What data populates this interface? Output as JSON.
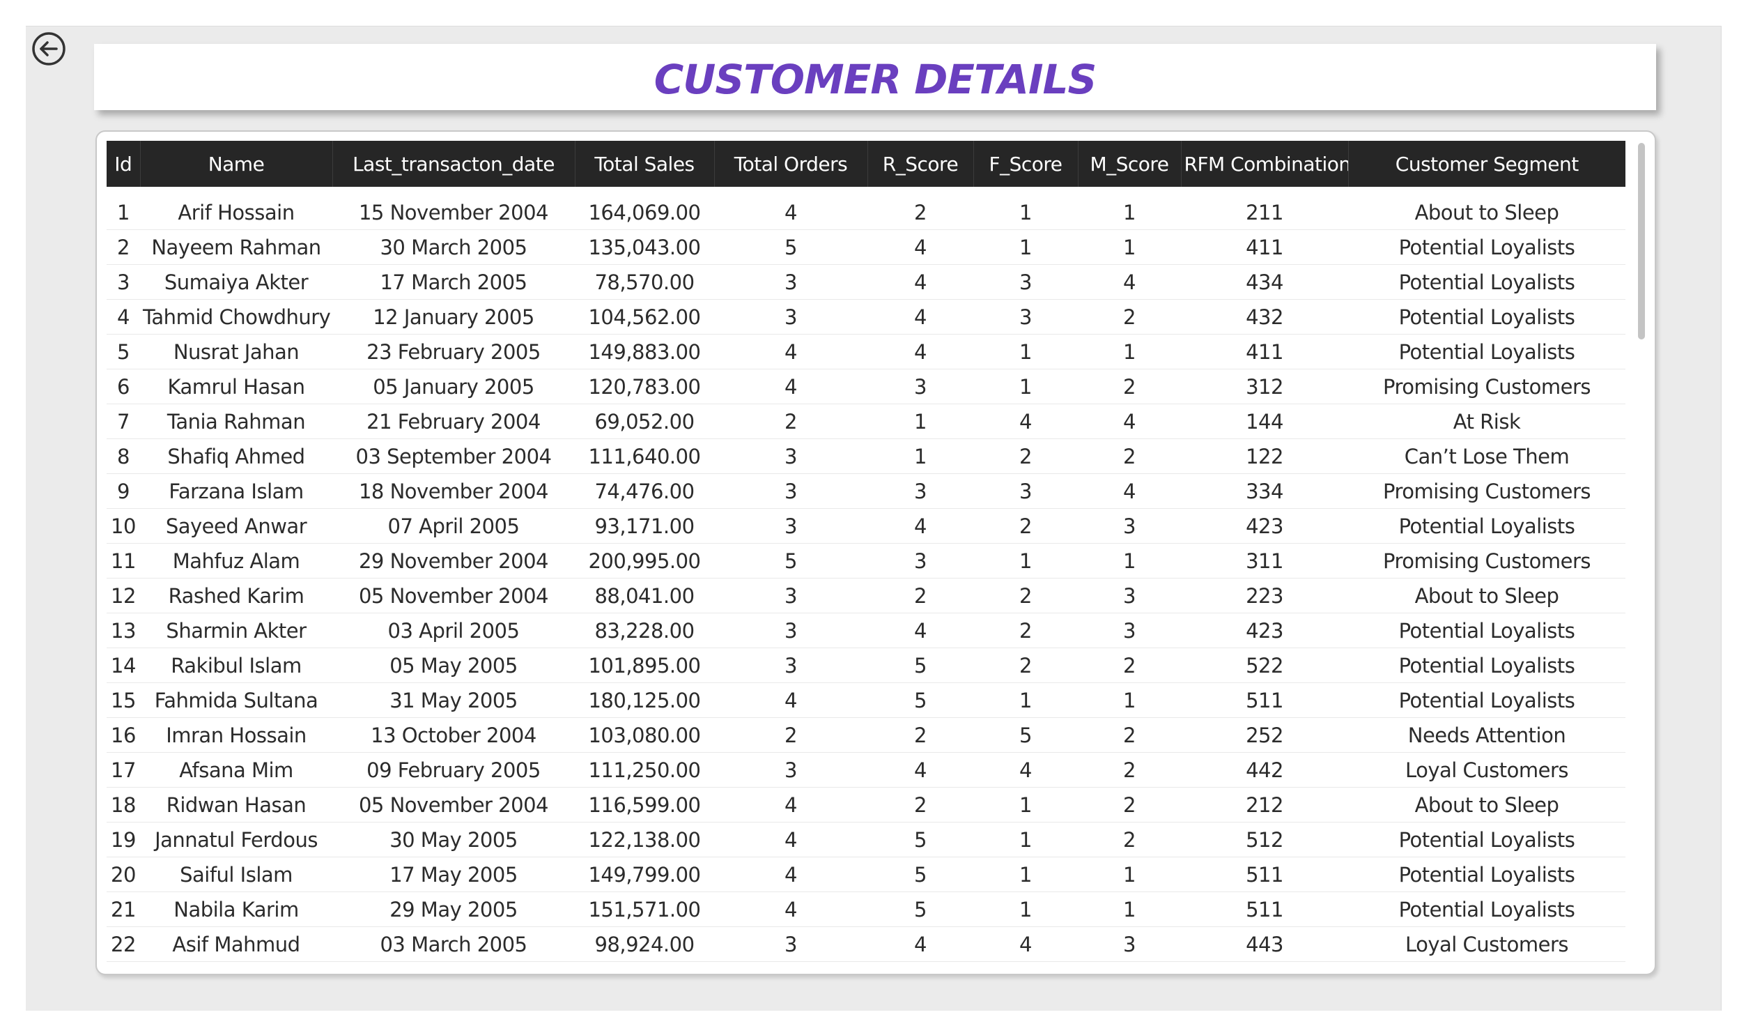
{
  "page": {
    "title": "CUSTOMER DETAILS",
    "title_color": "#6a3fbf",
    "back_icon": "back-arrow-circle-icon"
  },
  "table": {
    "columns": [
      "Id",
      "Name",
      "Last_transacton_date",
      "Total Sales",
      "Total Orders",
      "R_Score",
      "F_Score",
      "M_Score",
      "RFM Combination",
      "Customer Segment"
    ],
    "header_bg": "#262626",
    "rows": [
      [
        "1",
        "Arif Hossain",
        "15 November 2004",
        "164,069.00",
        "4",
        "2",
        "1",
        "1",
        "211",
        "About to Sleep"
      ],
      [
        "2",
        "Nayeem Rahman",
        "30 March 2005",
        "135,043.00",
        "5",
        "4",
        "1",
        "1",
        "411",
        "Potential Loyalists"
      ],
      [
        "3",
        "Sumaiya Akter",
        "17 March 2005",
        "78,570.00",
        "3",
        "4",
        "3",
        "4",
        "434",
        "Potential Loyalists"
      ],
      [
        "4",
        "Tahmid Chowdhury",
        "12 January 2005",
        "104,562.00",
        "3",
        "4",
        "3",
        "2",
        "432",
        "Potential Loyalists"
      ],
      [
        "5",
        "Nusrat Jahan",
        "23 February 2005",
        "149,883.00",
        "4",
        "4",
        "1",
        "1",
        "411",
        "Potential Loyalists"
      ],
      [
        "6",
        "Kamrul Hasan",
        "05 January 2005",
        "120,783.00",
        "4",
        "3",
        "1",
        "2",
        "312",
        "Promising Customers"
      ],
      [
        "7",
        "Tania Rahman",
        "21 February 2004",
        "69,052.00",
        "2",
        "1",
        "4",
        "4",
        "144",
        "At Risk"
      ],
      [
        "8",
        "Shafiq Ahmed",
        "03 September 2004",
        "111,640.00",
        "3",
        "1",
        "2",
        "2",
        "122",
        "Can’t Lose Them"
      ],
      [
        "9",
        "Farzana Islam",
        "18 November 2004",
        "74,476.00",
        "3",
        "3",
        "3",
        "4",
        "334",
        "Promising Customers"
      ],
      [
        "10",
        "Sayeed Anwar",
        "07 April 2005",
        "93,171.00",
        "3",
        "4",
        "2",
        "3",
        "423",
        "Potential Loyalists"
      ],
      [
        "11",
        "Mahfuz Alam",
        "29 November 2004",
        "200,995.00",
        "5",
        "3",
        "1",
        "1",
        "311",
        "Promising Customers"
      ],
      [
        "12",
        "Rashed Karim",
        "05 November 2004",
        "88,041.00",
        "3",
        "2",
        "2",
        "3",
        "223",
        "About to Sleep"
      ],
      [
        "13",
        "Sharmin Akter",
        "03 April 2005",
        "83,228.00",
        "3",
        "4",
        "2",
        "3",
        "423",
        "Potential Loyalists"
      ],
      [
        "14",
        "Rakibul Islam",
        "05 May 2005",
        "101,895.00",
        "3",
        "5",
        "2",
        "2",
        "522",
        "Potential Loyalists"
      ],
      [
        "15",
        "Fahmida Sultana",
        "31 May 2005",
        "180,125.00",
        "4",
        "5",
        "1",
        "1",
        "511",
        "Potential Loyalists"
      ],
      [
        "16",
        "Imran Hossain",
        "13 October 2004",
        "103,080.00",
        "2",
        "2",
        "5",
        "2",
        "252",
        "Needs Attention"
      ],
      [
        "17",
        "Afsana Mim",
        "09 February 2005",
        "111,250.00",
        "3",
        "4",
        "4",
        "2",
        "442",
        "Loyal Customers"
      ],
      [
        "18",
        "Ridwan Hasan",
        "05 November 2004",
        "116,599.00",
        "4",
        "2",
        "1",
        "2",
        "212",
        "About to Sleep"
      ],
      [
        "19",
        "Jannatul Ferdous",
        "30 May 2005",
        "122,138.00",
        "4",
        "5",
        "1",
        "2",
        "512",
        "Potential Loyalists"
      ],
      [
        "20",
        "Saiful Islam",
        "17 May 2005",
        "149,799.00",
        "4",
        "5",
        "1",
        "1",
        "511",
        "Potential Loyalists"
      ],
      [
        "21",
        "Nabila Karim",
        "29 May 2005",
        "151,571.00",
        "4",
        "5",
        "1",
        "1",
        "511",
        "Potential Loyalists"
      ],
      [
        "22",
        "Asif Mahmud",
        "03 March 2005",
        "98,924.00",
        "3",
        "4",
        "4",
        "3",
        "443",
        "Loyal Customers"
      ]
    ]
  }
}
